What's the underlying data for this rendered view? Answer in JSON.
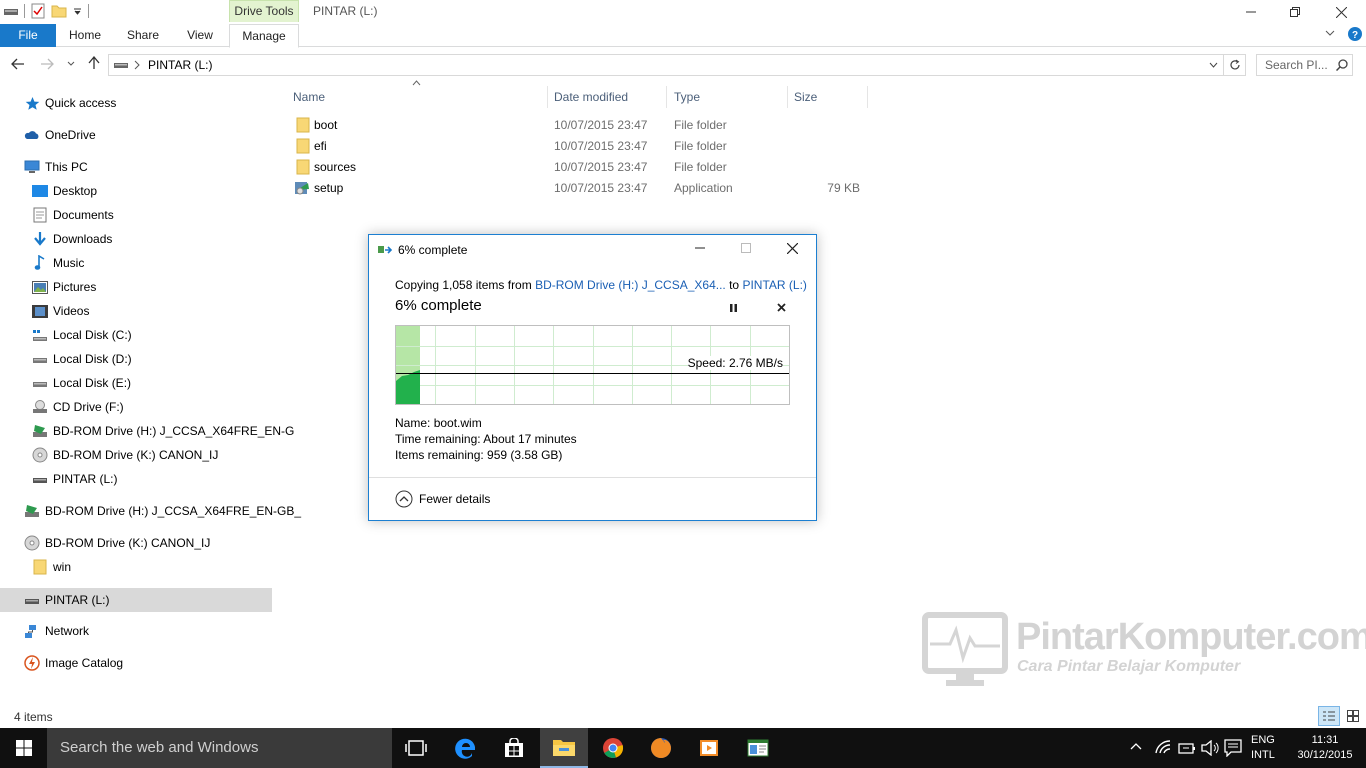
{
  "window": {
    "title": "PINTAR (L:)",
    "context_tab_group": "Drive Tools"
  },
  "ribbon": {
    "tabs": [
      "File",
      "Home",
      "Share",
      "View",
      "Manage"
    ]
  },
  "address": {
    "path": "PINTAR (L:)",
    "search_placeholder": "Search PI..."
  },
  "nav": {
    "quick_access": "Quick access",
    "onedrive": "OneDrive",
    "this_pc": "This PC",
    "pc_items": [
      "Desktop",
      "Documents",
      "Downloads",
      "Music",
      "Pictures",
      "Videos",
      "Local Disk (C:)",
      "Local Disk (D:)",
      "Local Disk (E:)",
      "CD Drive (F:)",
      "BD-ROM Drive (H:) J_CCSA_X64FRE_EN-G",
      "BD-ROM Drive (K:) CANON_IJ",
      "PINTAR (L:)"
    ],
    "bd_h": "BD-ROM Drive (H:) J_CCSA_X64FRE_EN-GB_",
    "bd_k": "BD-ROM Drive (K:) CANON_IJ",
    "win": "win",
    "pintar": "PINTAR (L:)",
    "network": "Network",
    "image_catalog": "Image Catalog"
  },
  "filelist": {
    "columns": [
      "Name",
      "Date modified",
      "Type",
      "Size"
    ],
    "rows": [
      {
        "name": "boot",
        "date": "10/07/2015 23:47",
        "type": "File folder",
        "size": ""
      },
      {
        "name": "efi",
        "date": "10/07/2015 23:47",
        "type": "File folder",
        "size": ""
      },
      {
        "name": "sources",
        "date": "10/07/2015 23:47",
        "type": "File folder",
        "size": ""
      },
      {
        "name": "setup",
        "date": "10/07/2015 23:47",
        "type": "Application",
        "size": "79 KB"
      }
    ]
  },
  "status": {
    "item_count": "4 items"
  },
  "dialog": {
    "title": "6% complete",
    "copy_prefix": "Copying 1,058 items from ",
    "source": "BD-ROM Drive (H:) J_CCSA_X64...",
    "to_word": " to ",
    "destination": "PINTAR (L:)",
    "percent_text": "6% complete",
    "progress_fraction": 0.06,
    "speed_label": "Speed: 2.76 MB/s",
    "name_label": "Name:",
    "name_value": "boot.wim",
    "time_label": "Time remaining:",
    "time_value": "About 17 minutes",
    "items_label": "Items remaining:",
    "items_value": "959 (3.58 GB)",
    "fewer_details": "Fewer details"
  },
  "watermark": {
    "brand": "PintarKomputer.com",
    "tagline": "Cara Pintar Belajar Komputer"
  },
  "taskbar": {
    "search_placeholder": "Search the web and Windows",
    "lang_top": "ENG",
    "lang_bottom": "INTL",
    "time": "11:31",
    "date": "30/12/2015"
  },
  "colors": {
    "accent": "#1979ca",
    "progress_green": "#22b14c",
    "graph_fill_light": "#b6e6a6"
  }
}
